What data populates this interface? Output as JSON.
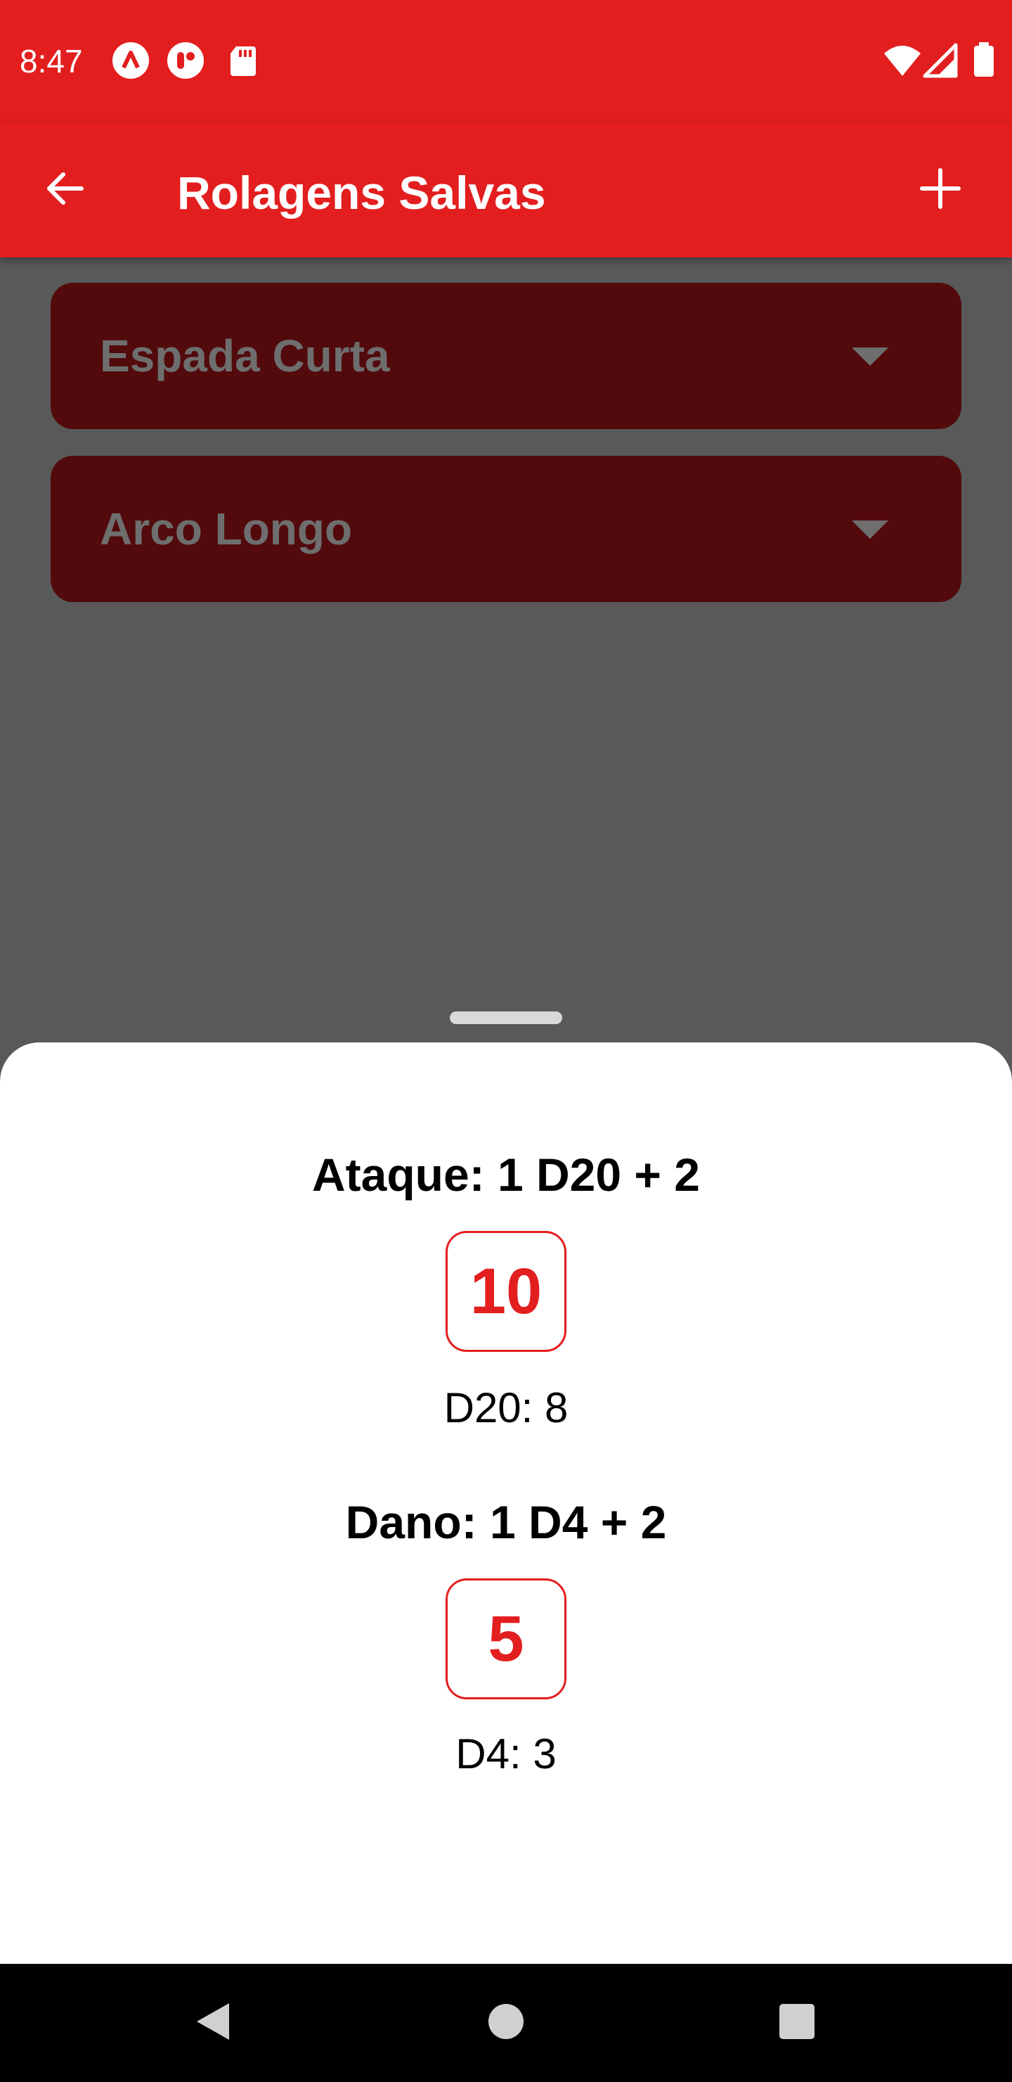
{
  "status_bar": {
    "time": "8:47",
    "left_icons": [
      "a-circle-icon",
      "toggle-circle-icon",
      "sd-card-icon"
    ],
    "right_icons": [
      "wifi-icon",
      "signal-icon",
      "battery-icon"
    ]
  },
  "app_bar": {
    "title": "Rolagens Salvas",
    "back_icon": "arrow-left-icon",
    "add_icon": "plus-icon"
  },
  "saved_rolls": [
    {
      "label": "Espada Curta"
    },
    {
      "label": "Arco Longo"
    }
  ],
  "sheet": {
    "attack": {
      "title": "Ataque: 1 D20 + 2",
      "total": "10",
      "detail": "D20: 8"
    },
    "damage": {
      "title": "Dano: 1 D4 + 2",
      "total": "5",
      "detail": "D4: 3"
    }
  },
  "colors": {
    "primary": "#E31E1F",
    "card_dark": "#520A0C",
    "scrim": "#595959"
  },
  "nav_bar": {
    "icons": [
      "back-triangle-icon",
      "home-circle-icon",
      "recents-square-icon"
    ]
  }
}
